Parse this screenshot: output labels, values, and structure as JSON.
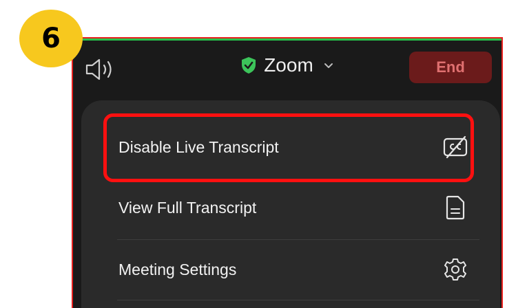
{
  "step": {
    "number": "6",
    "color": "#f7c81e"
  },
  "topbar": {
    "title": "Zoom",
    "end_label": "End",
    "accent_green": "#27c24c",
    "end_color": "#6b1b1b",
    "icons": [
      "speaker-icon",
      "shield-check-icon",
      "chevron-down-icon"
    ]
  },
  "menu": {
    "items": [
      {
        "label": "Disable Live Transcript",
        "icon": "closed-caption-off-icon"
      },
      {
        "label": "View Full Transcript",
        "icon": "document-icon"
      },
      {
        "label": "Meeting Settings",
        "icon": "gear-icon"
      }
    ],
    "highlight_color": "#ff1010"
  }
}
